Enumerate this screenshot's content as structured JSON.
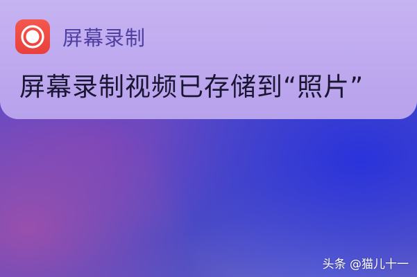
{
  "notification": {
    "app_name": "屏幕录制",
    "app_icon": "screen-record-icon",
    "message": "屏幕录制视频已存储到“照片”"
  },
  "watermark": {
    "text": "头条 @猫儿十一"
  },
  "colors": {
    "banner_background": "#c1adf0",
    "app_name": "#4e3ea0",
    "message": "#1a1532",
    "icon_red": "#ec4740",
    "wallpaper_purple": "#6f4dc8",
    "wallpaper_blue": "#2f34d8"
  }
}
